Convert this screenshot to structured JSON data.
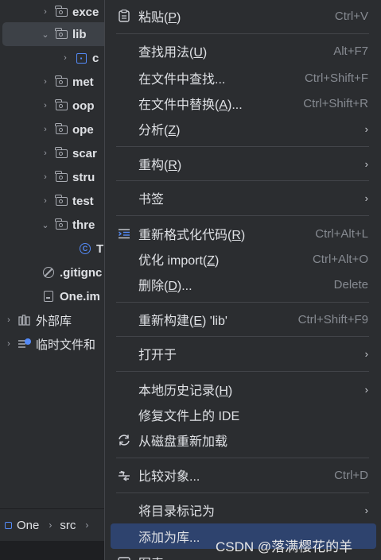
{
  "tree": {
    "items": [
      {
        "label": "exce",
        "chevron": "›",
        "icon": "folder-icon"
      },
      {
        "label": "lib",
        "chevron": "⌄",
        "icon": "folder-icon"
      },
      {
        "label": "c",
        "chevron": "›",
        "icon": "module-icon"
      },
      {
        "label": "met",
        "chevron": "›",
        "icon": "folder-icon"
      },
      {
        "label": "oop",
        "chevron": "›",
        "icon": "folder-icon"
      },
      {
        "label": "ope",
        "chevron": "›",
        "icon": "folder-icon"
      },
      {
        "label": "scar",
        "chevron": "›",
        "icon": "folder-icon"
      },
      {
        "label": "stru",
        "chevron": "›",
        "icon": "folder-icon"
      },
      {
        "label": "test",
        "chevron": "›",
        "icon": "folder-icon"
      },
      {
        "label": "thre",
        "chevron": "⌄",
        "icon": "folder-icon"
      },
      {
        "label": "T",
        "chevron": "",
        "icon": "class-icon"
      },
      {
        "label": ".gitignc",
        "chevron": "",
        "icon": "ignore-file-icon"
      },
      {
        "label": "One.im",
        "chevron": "",
        "icon": "iml-file-icon"
      },
      {
        "label": "外部库",
        "chevron": "›",
        "icon": "library-icon"
      },
      {
        "label": "临时文件和",
        "chevron": "›",
        "icon": "scratch-icon"
      }
    ]
  },
  "breadcrumb": {
    "items": [
      "One",
      "src"
    ]
  },
  "menu": {
    "items": [
      {
        "label_pre": "粘贴(",
        "mnemonic": "P",
        "label_post": ")",
        "shortcut": "Ctrl+V",
        "icon": "clipboard-icon"
      },
      {
        "label_pre": "查找用法(",
        "mnemonic": "U",
        "label_post": ")",
        "shortcut": "Alt+F7"
      },
      {
        "label_pre": "在文件中查找...",
        "mnemonic": "",
        "label_post": "",
        "shortcut": "Ctrl+Shift+F"
      },
      {
        "label_pre": "在文件中替换(",
        "mnemonic": "A",
        "label_post": ")...",
        "shortcut": "Ctrl+Shift+R"
      },
      {
        "label_pre": "分析(",
        "mnemonic": "Z",
        "label_post": ")",
        "submenu": "›"
      },
      {
        "label_pre": "重构(",
        "mnemonic": "R",
        "label_post": ")",
        "submenu": "›"
      },
      {
        "label_pre": "书签",
        "mnemonic": "",
        "label_post": "",
        "submenu": "›"
      },
      {
        "label_pre": "重新格式化代码(",
        "mnemonic": "R",
        "label_post": ")",
        "shortcut": "Ctrl+Alt+L",
        "icon": "reformat-icon"
      },
      {
        "label_pre": "优化 import(",
        "mnemonic": "Z",
        "label_post": ")",
        "shortcut": "Ctrl+Alt+O"
      },
      {
        "label_pre": "删除(",
        "mnemonic": "D",
        "label_post": ")...",
        "shortcut": "Delete"
      },
      {
        "label_pre": "重新构建(",
        "mnemonic": "E",
        "label_post": ") 'lib'",
        "shortcut": "Ctrl+Shift+F9"
      },
      {
        "label_pre": "打开于",
        "mnemonic": "",
        "label_post": "",
        "submenu": "›"
      },
      {
        "label_pre": "本地历史记录(",
        "mnemonic": "H",
        "label_post": ")",
        "submenu": "›"
      },
      {
        "label_pre": "修复文件上的 IDE",
        "mnemonic": "",
        "label_post": ""
      },
      {
        "label_pre": "从磁盘重新加载",
        "mnemonic": "",
        "label_post": "",
        "icon": "reload-icon"
      },
      {
        "label_pre": "比较对象...",
        "mnemonic": "",
        "label_post": "",
        "shortcut": "Ctrl+D",
        "icon": "compare-icon"
      },
      {
        "label_pre": "将目录标记为",
        "mnemonic": "",
        "label_post": "",
        "submenu": "›"
      },
      {
        "label_pre": "添加为库...",
        "mnemonic": "",
        "label_post": ""
      },
      {
        "label_pre": "图表",
        "mnemonic": "",
        "label_post": "",
        "submenu": "›"
      }
    ]
  },
  "watermark": "CSDN @落满樱花的羊",
  "colors": {
    "background": "#2b2d30",
    "highlight": "#2e436e",
    "accent": "#548af7"
  }
}
